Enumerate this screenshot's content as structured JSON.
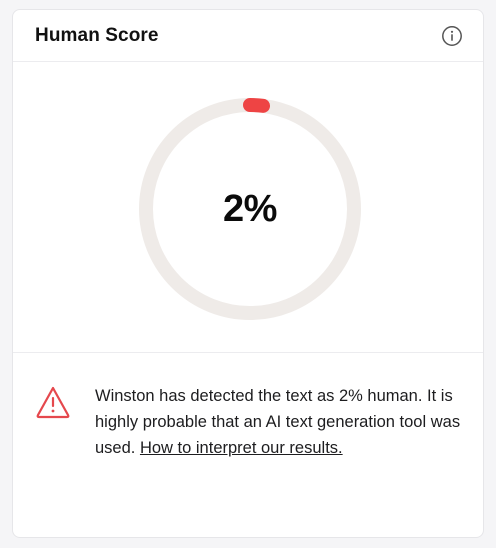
{
  "card": {
    "title": "Human Score",
    "info_icon": "info-circle-icon"
  },
  "gauge": {
    "value_label": "2%",
    "value_fraction": 0.02,
    "track_color": "#efebe8",
    "fill_color": "#ee4444"
  },
  "message": {
    "icon": "warning-triangle-icon",
    "icon_color": "#e5484d",
    "text": "Winston has detected the text as 2% human. It is highly probable that an AI text generation tool was used.",
    "link_label": "How to interpret our results."
  }
}
